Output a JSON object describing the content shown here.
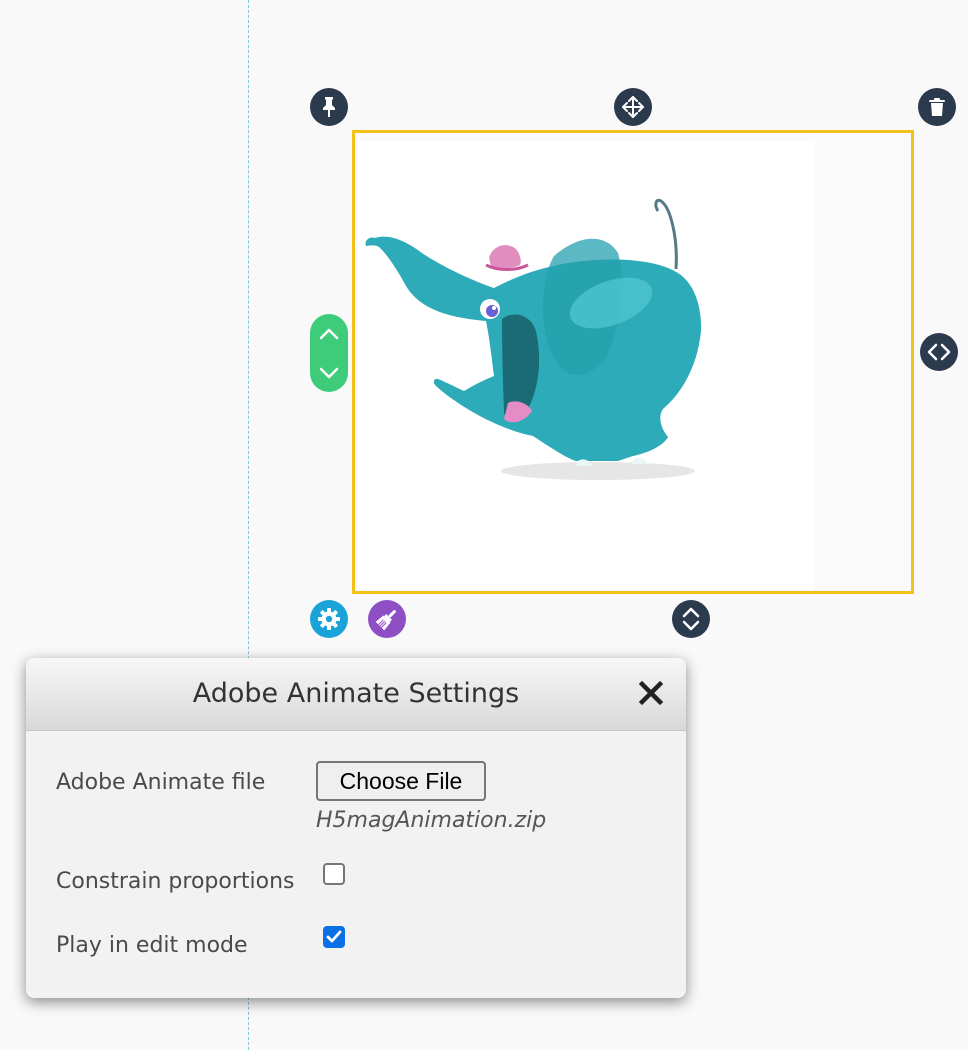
{
  "dialog": {
    "title": "Adobe Animate Settings",
    "fields": {
      "file_label": "Adobe Animate file",
      "file_button_label": "Choose File",
      "file_name": "H5magAnimation.zip",
      "constrain_label": "Constrain proportions",
      "constrain_checked": false,
      "play_label": "Play in edit mode",
      "play_checked": true
    }
  },
  "element_toolbar": {
    "icons": [
      "pin-icon",
      "move-icon",
      "trash-icon",
      "resize-horizontal-icon",
      "resize-vertical-icon",
      "gear-icon",
      "brush-icon",
      "chevron-up-icon",
      "chevron-down-icon",
      "close-icon"
    ]
  },
  "colors": {
    "selection_border": "#f2c11a",
    "handle_dark": "#2b3a4c",
    "settings_blue": "#1aa3d9",
    "style_purple": "#8e4fc5",
    "vertical_control_green": "#3fcc7a",
    "checkbox_checked": "#0b6fe6"
  }
}
